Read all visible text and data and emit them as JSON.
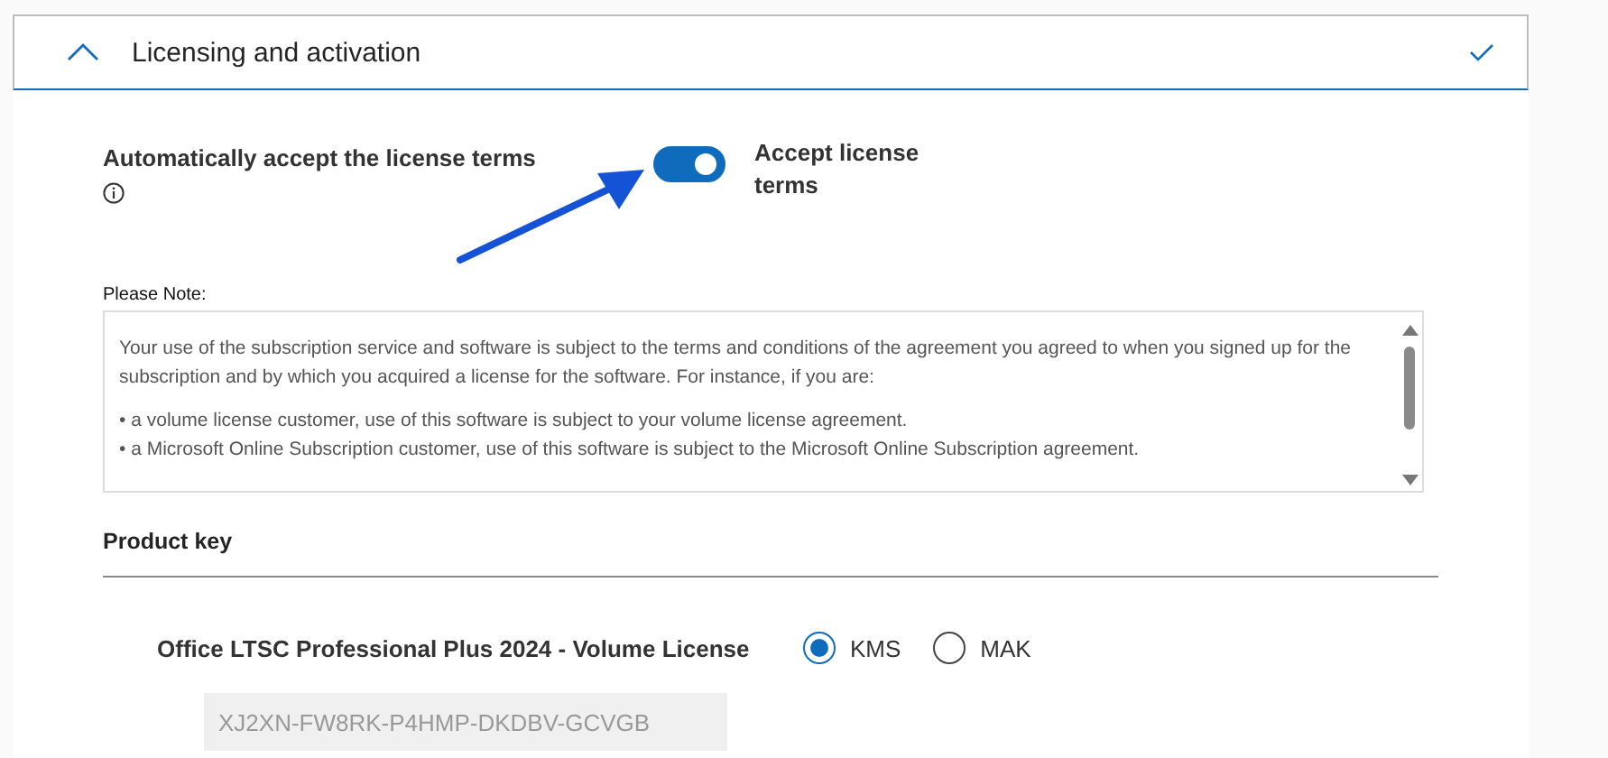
{
  "section": {
    "title": "Licensing and activation",
    "expanded": true,
    "completed": true
  },
  "auto_accept": {
    "label": "Automatically accept the license terms",
    "toggle_label": "Accept license terms",
    "on": true
  },
  "note": {
    "label": "Please Note:",
    "paragraphs": [
      "Your use of the subscription service and software is subject to the terms and conditions of the agreement you agreed to when you signed up for the subscription and by which you acquired a license for the software. For instance, if you are:",
      "• a volume license customer, use of this software is subject to your volume license agreement.\n• a Microsoft Online Subscription customer, use of this software is subject to the Microsoft Online Subscription agreement."
    ]
  },
  "product_key": {
    "heading": "Product key",
    "product": "Office LTSC Professional Plus 2024 - Volume License",
    "options": [
      {
        "label": "KMS",
        "selected": true
      },
      {
        "label": "MAK",
        "selected": false
      }
    ],
    "key": "XJ2XN-FW8RK-P4HMP-DKDBV-GCVGB"
  }
}
